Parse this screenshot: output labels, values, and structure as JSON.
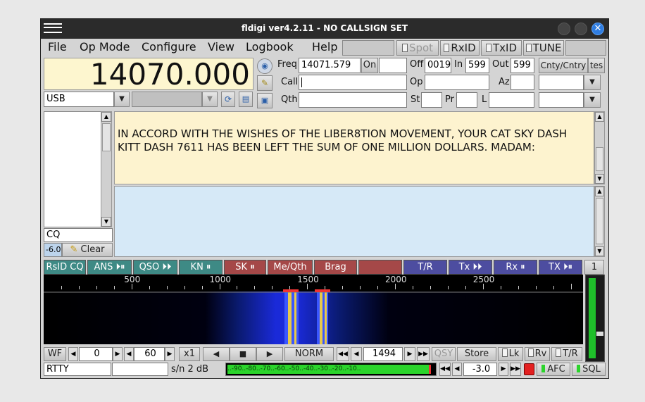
{
  "window": {
    "title": "fldigi ver4.2.11 - NO CALLSIGN SET"
  },
  "menu": {
    "file": "File",
    "op_mode": "Op Mode",
    "configure": "Configure",
    "view": "View",
    "logbook": "Logbook",
    "help": "Help",
    "spot": "Spot",
    "rxid": "RxID",
    "txid": "TxID",
    "tune": "TUNE"
  },
  "freq_display": "14070.000",
  "mode_select": "USB",
  "log": {
    "freq_label": "Freq",
    "freq_value": "14071.579",
    "on_btn": "On",
    "off_label": "Off",
    "off_value": "0019",
    "in_label": "In",
    "in_value": "599",
    "out_label": "Out",
    "out_value": "599",
    "cnty_btn": "Cnty/Cntry",
    "tes_btn": "tes",
    "call_label": "Call",
    "call_value": "",
    "op_label": "Op",
    "op_value": "",
    "az_label": "Az",
    "az_value": "",
    "qth_label": "Qth",
    "qth_value": "",
    "st_label": "St",
    "pr_label": "Pr",
    "l_label": "L"
  },
  "rx_text": "IN ACCORD WITH THE WISHES OF THE LIBER8TION MOVEMENT, YOUR CAT SKY DASH KITT DASH 7611 HAS BEEN LEFT THE SUM OF ONE MILLION DOLLARS. MADAM:",
  "side": {
    "cq": "CQ",
    "level": "-6.0",
    "clear": "Clear"
  },
  "macros": [
    {
      "label": "RsID CQ",
      "glyph": "",
      "color": "#3e8a85"
    },
    {
      "label": "ANS",
      "glyph": "⏵⏸",
      "color": "#3e8a85"
    },
    {
      "label": "QSO",
      "glyph": "⏵⏵",
      "color": "#3e8a85"
    },
    {
      "label": "KN",
      "glyph": "⏸",
      "color": "#3e8a85"
    },
    {
      "label": "SK",
      "glyph": "⏸",
      "color": "#a54848"
    },
    {
      "label": "Me/Qth",
      "glyph": "",
      "color": "#a54848"
    },
    {
      "label": "Brag",
      "glyph": "",
      "color": "#a54848"
    },
    {
      "label": "",
      "glyph": "",
      "color": "#a54848"
    },
    {
      "label": "T/R",
      "glyph": "",
      "color": "#4d4da0"
    },
    {
      "label": "Tx",
      "glyph": "⏵⏵",
      "color": "#4d4da0"
    },
    {
      "label": "Rx",
      "glyph": "⏸",
      "color": "#4d4da0"
    },
    {
      "label": "TX",
      "glyph": "⏵⏸",
      "color": "#4d4da0"
    }
  ],
  "macro_page": "1",
  "scale_labels": [
    "500",
    "1000",
    "1500",
    "2000",
    "2500"
  ],
  "controls": {
    "wf": "WF",
    "gain": "0",
    "range": "60",
    "zoom": "x1",
    "norm": "NORM",
    "carrier": "1494",
    "qsy": "QSY",
    "store": "Store",
    "lk": "Lk",
    "rv": "Rv",
    "tr": "T/R"
  },
  "status": {
    "mode": "RTTY",
    "sn": "s/n  2   dB",
    "meter": "..-90..-80..-70..-60..-50..-40..-30..-20..-10..",
    "squelch": "-3.0",
    "afc": "AFC",
    "sql": "SQL"
  },
  "colors": {
    "freq_bg": "#fdf6cf",
    "rx_bg": "#fdf3cf",
    "tx_bg": "#d6e9f7",
    "waterfall_bg": "#000000"
  }
}
